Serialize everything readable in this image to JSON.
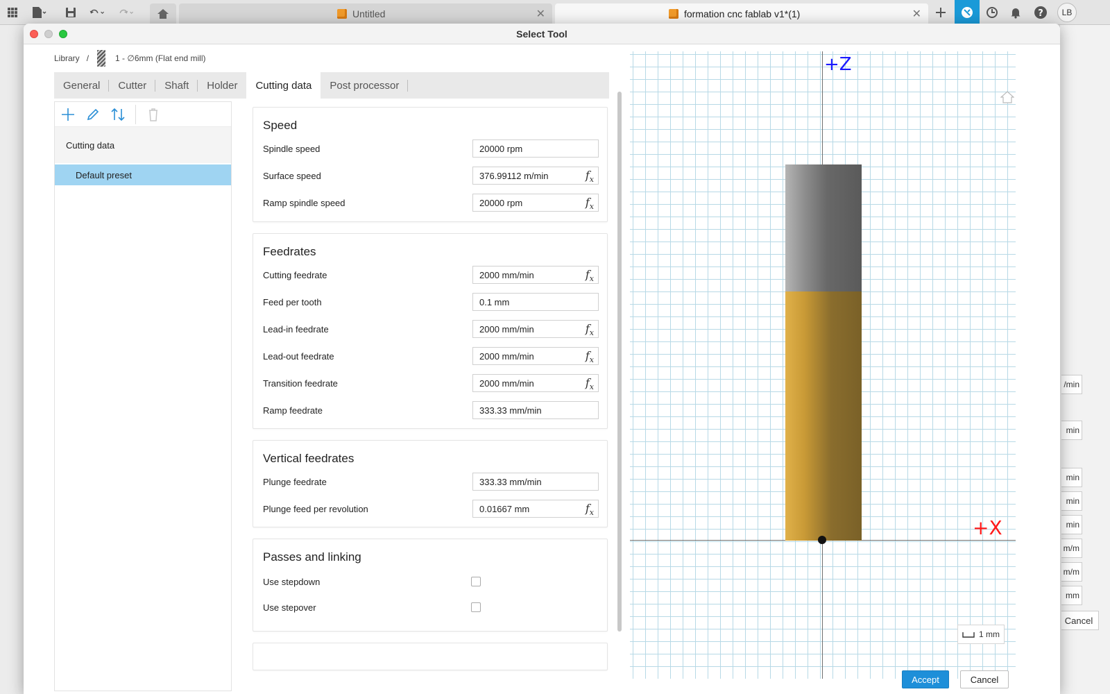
{
  "app": {
    "tabs": [
      {
        "label": "Untitled",
        "active": false
      },
      {
        "label": "formation cnc fablab v1*(1)",
        "active": true
      }
    ],
    "user_initials": "LB"
  },
  "dialog": {
    "title": "Select Tool",
    "breadcrumb": {
      "root": "Library",
      "separator": "/",
      "tool": "1 - ∅6mm (Flat end mill)"
    },
    "tabs": [
      {
        "label": "General",
        "active": false
      },
      {
        "label": "Cutter",
        "active": false
      },
      {
        "label": "Shaft",
        "active": false
      },
      {
        "label": "Holder",
        "active": false
      },
      {
        "label": "Cutting data",
        "active": true
      },
      {
        "label": "Post processor",
        "active": false
      }
    ],
    "presets": {
      "group": "Cutting data",
      "items": [
        "Default preset"
      ]
    },
    "sections": {
      "speed": {
        "title": "Speed",
        "rows": [
          {
            "label": "Spindle speed",
            "value": "20000 rpm",
            "fx": false
          },
          {
            "label": "Surface speed",
            "value": "376.99112 m/min",
            "fx": true
          },
          {
            "label": "Ramp spindle speed",
            "value": "20000 rpm",
            "fx": true
          }
        ]
      },
      "feedrates": {
        "title": "Feedrates",
        "rows": [
          {
            "label": "Cutting feedrate",
            "value": "2000 mm/min",
            "fx": true
          },
          {
            "label": "Feed per tooth",
            "value": "0.1 mm",
            "fx": false
          },
          {
            "label": "Lead-in feedrate",
            "value": "2000 mm/min",
            "fx": true
          },
          {
            "label": "Lead-out feedrate",
            "value": "2000 mm/min",
            "fx": true
          },
          {
            "label": "Transition feedrate",
            "value": "2000 mm/min",
            "fx": true
          },
          {
            "label": "Ramp feedrate",
            "value": "333.33 mm/min",
            "fx": false
          }
        ]
      },
      "vertical": {
        "title": "Vertical feedrates",
        "rows": [
          {
            "label": "Plunge feedrate",
            "value": "333.33 mm/min",
            "fx": false
          },
          {
            "label": "Plunge feed per revolution",
            "value": "0.01667 mm",
            "fx": true
          }
        ]
      },
      "passes": {
        "title": "Passes and linking",
        "rows": [
          {
            "label": "Use stepdown",
            "checked": false
          },
          {
            "label": "Use stepover",
            "checked": false
          }
        ]
      }
    },
    "fx_label": "f",
    "fx_sub": "x",
    "viewport": {
      "z_label": "+Z",
      "x_label": "+X",
      "scale": "1 mm",
      "z_color": "#1a1aff",
      "x_color": "#ff1a1a"
    },
    "buttons": {
      "accept": "Accept",
      "cancel": "Cancel"
    }
  },
  "background": {
    "fields": [
      "/min",
      "min",
      "min",
      "min",
      "min",
      "m/m",
      "m/m",
      "mm"
    ],
    "cancel": "Cancel"
  },
  "colors": {
    "accent": "#1e8fd9",
    "selected_preset": "#9fd4f2",
    "grid": "#b7d9e6"
  }
}
